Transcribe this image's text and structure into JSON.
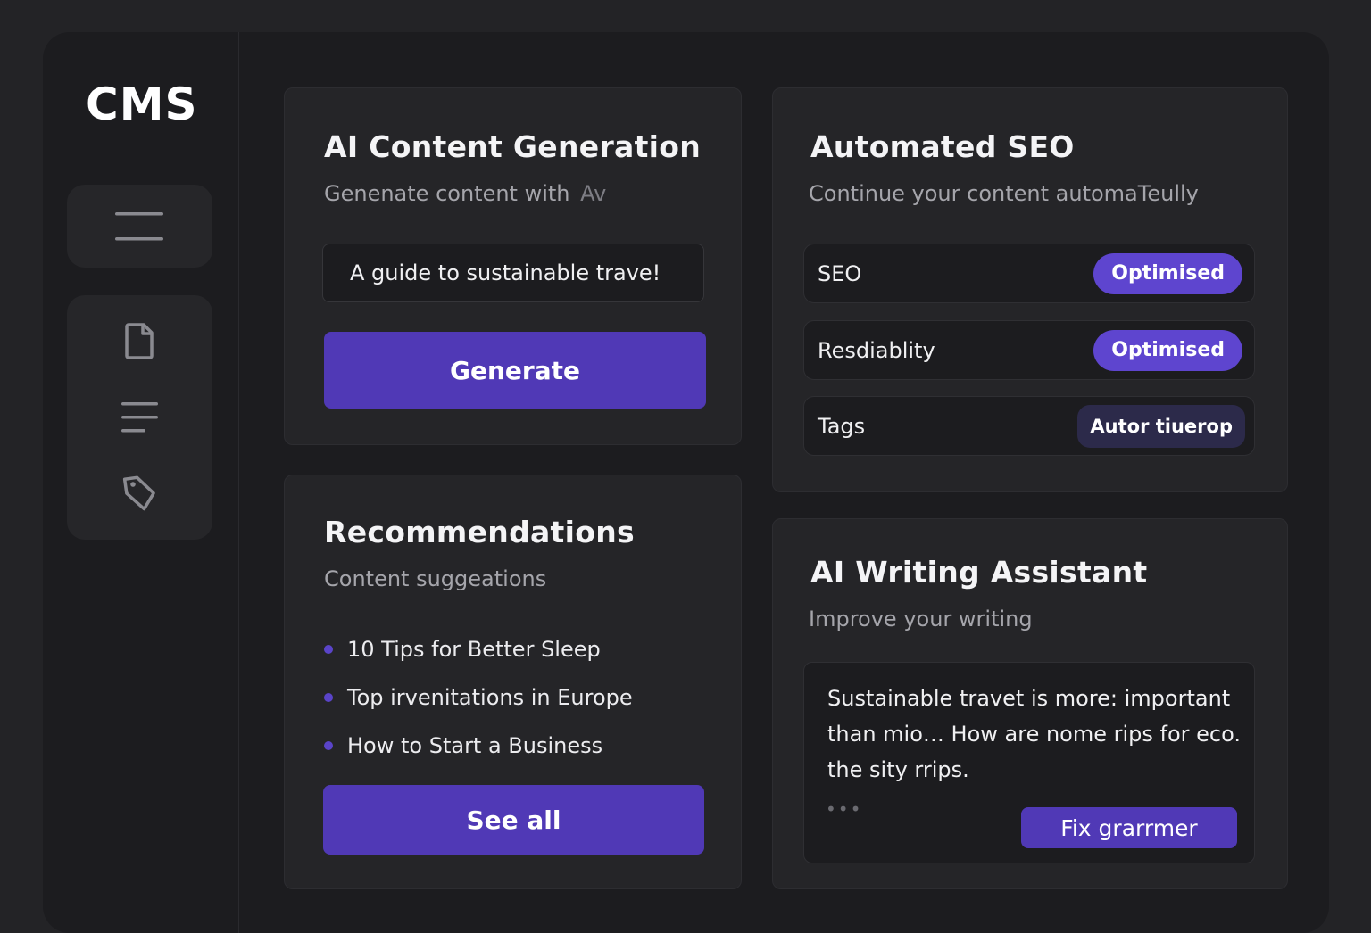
{
  "sidebar": {
    "logo": "CMS",
    "icons": [
      "menu-icon",
      "document-icon",
      "list-icon",
      "tag-icon"
    ]
  },
  "ai_content": {
    "title": "AI Content Generation",
    "subtitle": "Genenate content with",
    "subtitle_glyph": "Av",
    "input_value": "A guide to sustainable trave!",
    "button_label": "Generate"
  },
  "seo": {
    "title": "Automated SEO",
    "subtitle": "Continue your content automaTeully",
    "rows": [
      {
        "label": "SEO",
        "status": "Optimised"
      },
      {
        "label": "Resdiablity",
        "status": "Optimised"
      },
      {
        "label": "Tags",
        "status": "Autor tiuerop"
      }
    ]
  },
  "recommendations": {
    "title": "Recommendations",
    "subtitle": "Content suggeations",
    "items": [
      "10 Tips for Better Sleep",
      "Top irvenitations in Europe",
      "How to Start a Business"
    ],
    "button_label": "See all"
  },
  "writing": {
    "title": "AI Writing Assistant",
    "subtitle": "Improve your writing",
    "text": "Sustainable travet is more: important than mio… How are nome rips for eco. the sity rrips.",
    "ellipsis": "•••",
    "button_label": "Fix grarrmer"
  },
  "colors": {
    "accent": "#5039b6",
    "badge": "#5e45cf",
    "background": "#1c1c1f",
    "card": "#252528"
  }
}
